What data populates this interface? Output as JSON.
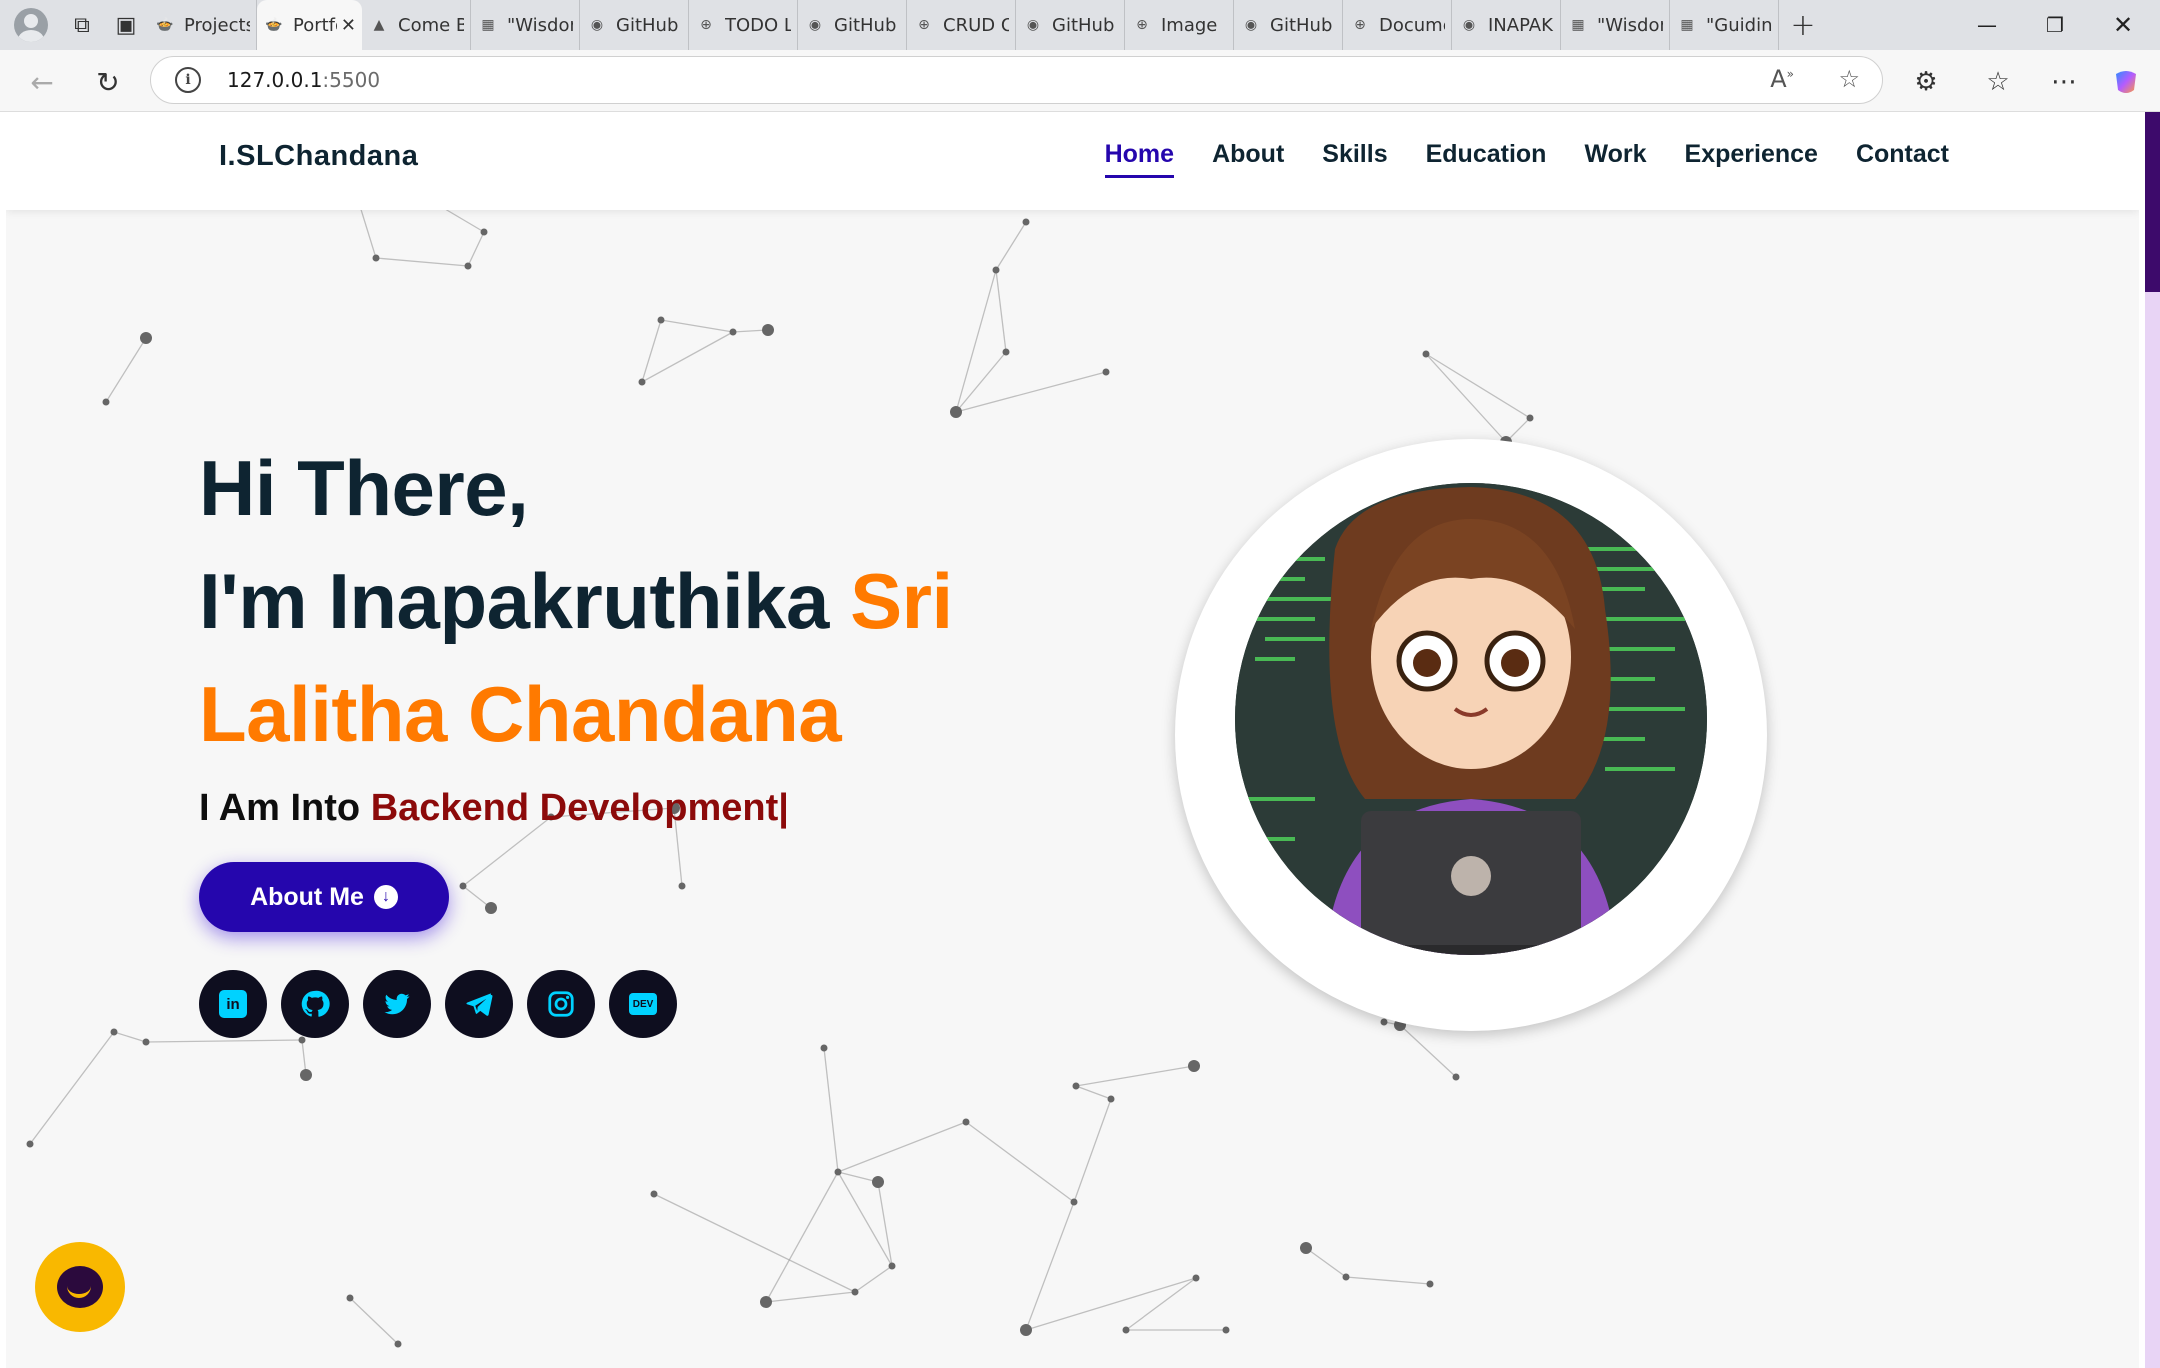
{
  "browser": {
    "tabs": [
      {
        "title": "Projects",
        "icon": "sketch-logo-icon"
      },
      {
        "title": "Portfolio",
        "icon": "sketch-logo-icon",
        "active": true
      },
      {
        "title": "Come Build",
        "icon": "flutter-icon"
      },
      {
        "title": "\"Wisdom",
        "icon": "clapper-icon"
      },
      {
        "title": "GitHub",
        "icon": "github-icon"
      },
      {
        "title": "TODO List",
        "icon": "globe-icon"
      },
      {
        "title": "GitHub",
        "icon": "github-icon"
      },
      {
        "title": "CRUD Operations",
        "icon": "globe-icon"
      },
      {
        "title": "GitHub",
        "icon": "github-icon"
      },
      {
        "title": "Image",
        "icon": "globe-icon"
      },
      {
        "title": "GitHub",
        "icon": "github-icon"
      },
      {
        "title": "Documents",
        "icon": "globe-icon"
      },
      {
        "title": "INAPAKRUTHIKA",
        "icon": "github-icon"
      },
      {
        "title": "\"Wisdom",
        "icon": "clapper-icon"
      },
      {
        "title": "\"Guiding",
        "icon": "clapper-icon"
      }
    ],
    "url_host": "127.0.0.1",
    "url_port": ":5500"
  },
  "nav": {
    "brand": "I.SLChandana",
    "items": [
      "Home",
      "About",
      "Skills",
      "Education",
      "Work",
      "Experience",
      "Contact"
    ],
    "active": "Home"
  },
  "hero": {
    "line1": "Hi There,",
    "line2_name": "I'm Inapakruthika ",
    "line2_accent": "Sri",
    "line3_accent": "Lalitha Chandana",
    "role_prefix": "I Am Into ",
    "role_value": "Backend Development|",
    "button_label": "About Me",
    "socials": [
      "linkedin",
      "github",
      "twitter",
      "telegram",
      "instagram",
      "dev"
    ]
  },
  "colors": {
    "brand_navy": "#0e2431",
    "accent_orange": "#ff7a00",
    "button_blue": "#2506ad",
    "role_red": "#8c0a0a",
    "social_cyan": "#00d2ff",
    "chat_yellow": "#f9b800"
  }
}
